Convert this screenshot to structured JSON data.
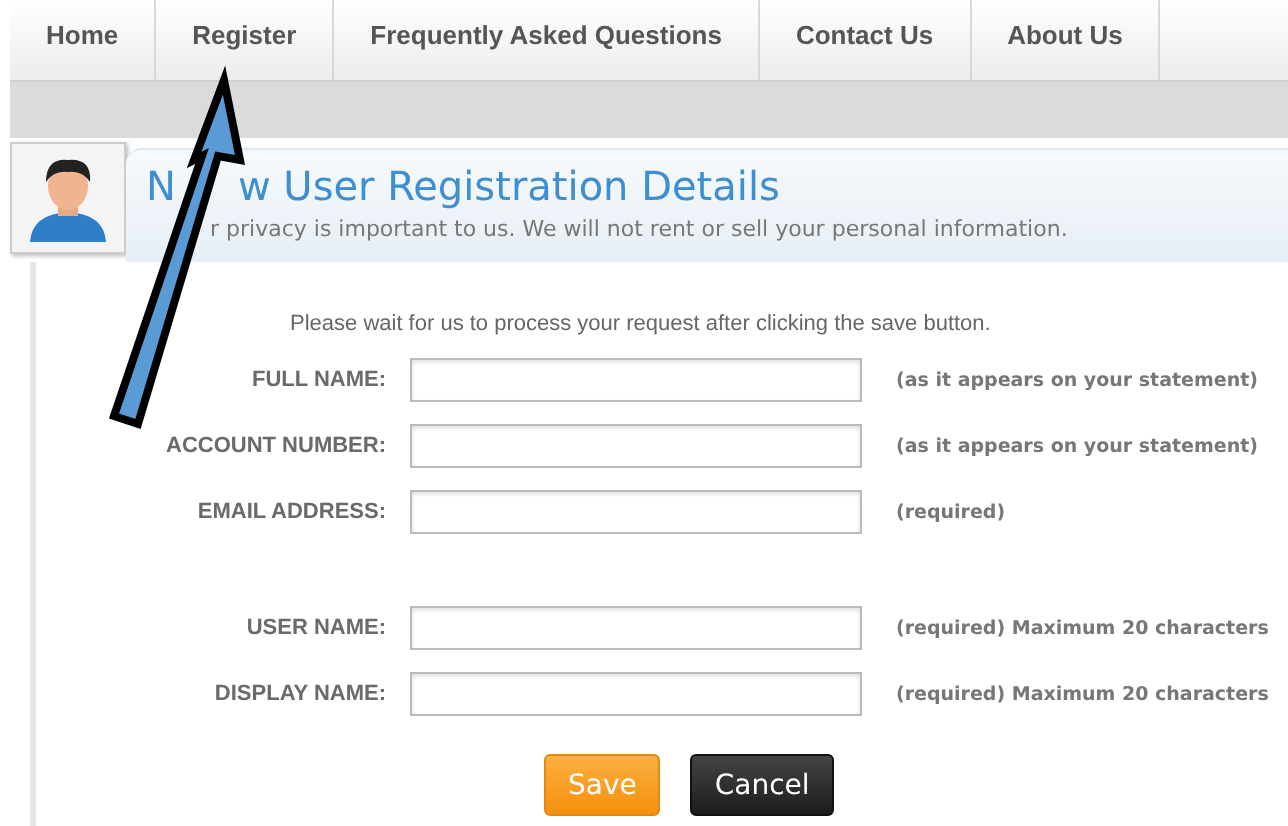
{
  "nav": {
    "tabs": [
      {
        "label": "Home",
        "selected": false
      },
      {
        "label": "Register",
        "selected": false
      },
      {
        "label": "Frequently Asked Questions",
        "selected": false
      },
      {
        "label": "Contact Us",
        "selected": false
      },
      {
        "label": "About Us",
        "selected": false
      }
    ]
  },
  "header": {
    "title_visible_start": "N",
    "title_visible_rest": "w User Registration Details",
    "subtitle_visible": "r privacy is important to us. We will not rent or sell your personal information."
  },
  "form": {
    "notice": "Please wait for us to process your request after clicking the save button.",
    "field_groups": [
      [
        {
          "label": "FULL NAME:",
          "hint": "(as it appears on your statement)"
        },
        {
          "label": "ACCOUNT NUMBER:",
          "hint": "(as it appears on your statement)"
        },
        {
          "label": "EMAIL ADDRESS:",
          "hint": "(required)"
        }
      ],
      [
        {
          "label": "USER NAME:",
          "hint": "(required) Maximum 20 characters"
        },
        {
          "label": "DISPLAY NAME:",
          "hint": "(required) Maximum 20 characters"
        }
      ]
    ],
    "buttons": [
      {
        "label": "Save",
        "kind": "primary"
      },
      {
        "label": "Cancel",
        "kind": "secondary"
      }
    ]
  }
}
